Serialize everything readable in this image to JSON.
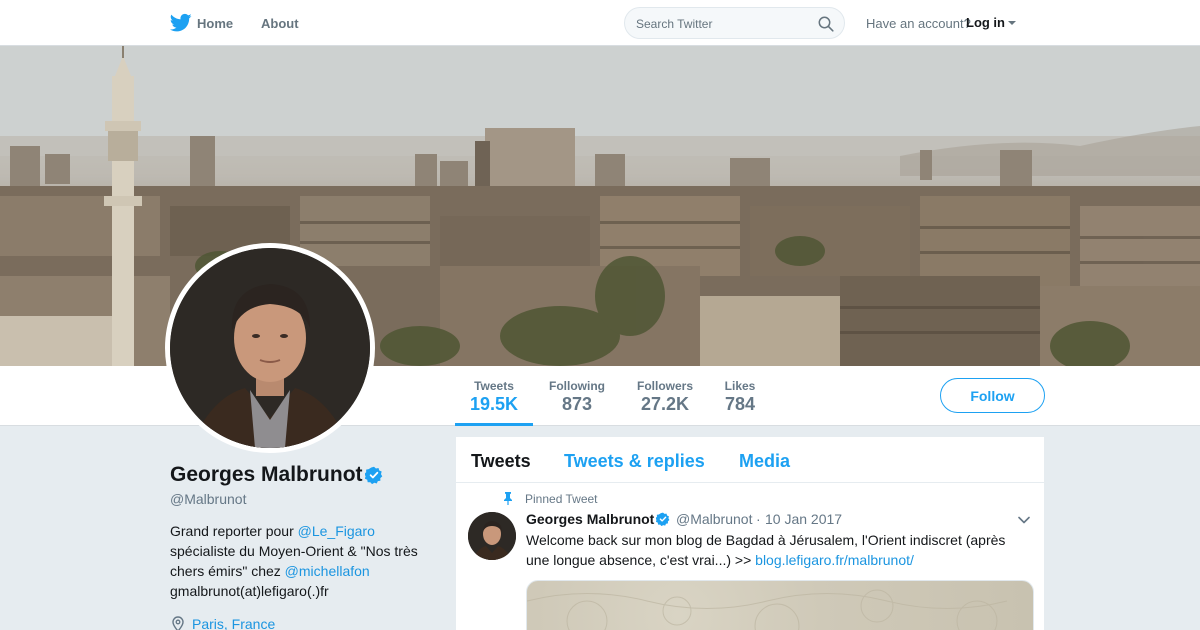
{
  "nav": {
    "home_label": "Home",
    "about_label": "About",
    "search_placeholder": "Search Twitter",
    "have_account": "Have an account?",
    "login_label": "Log in"
  },
  "profile": {
    "name": "Georges Malbrunot",
    "handle": "@Malbrunot",
    "bio": {
      "part1": "Grand reporter pour ",
      "mention1": "@Le_Figaro",
      "part2": " spécialiste du Moyen-Orient & \"Nos très chers émirs\" chez ",
      "mention2": "@michellafon",
      "part3": " gmalbrunot(at)lefigaro(.)fr"
    },
    "location": "Paris, France"
  },
  "stats": {
    "tweets_label": "Tweets",
    "tweets_value": "19.5K",
    "following_label": "Following",
    "following_value": "873",
    "followers_label": "Followers",
    "followers_value": "27.2K",
    "likes_label": "Likes",
    "likes_value": "784"
  },
  "follow_label": "Follow",
  "timeline": {
    "tabs": [
      "Tweets",
      "Tweets & replies",
      "Media"
    ],
    "pinned_label": "Pinned Tweet",
    "tweet": {
      "name": "Georges Malbrunot",
      "handle": "@Malbrunot",
      "separator": "·",
      "date": "10 Jan 2017",
      "text": "Welcome back sur mon blog de Bagdad à Jérusalem, l'Orient indiscret (après une longue absence, c'est vrai...) >> ",
      "link": "blog.lefigaro.fr/malbrunot/"
    }
  },
  "colors": {
    "accent": "#1da1f2",
    "link": "#1b95e0",
    "background": "#e6ecf0"
  }
}
